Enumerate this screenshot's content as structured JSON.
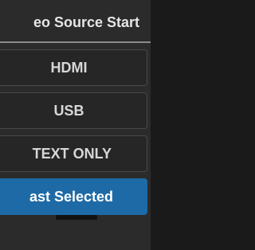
{
  "panel": {
    "title": "eo Source Start",
    "options": [
      {
        "label": "HDMI",
        "selected": false
      },
      {
        "label": "USB",
        "selected": false
      },
      {
        "label": "TEXT ONLY",
        "selected": false
      },
      {
        "label": "ast Selected",
        "selected": true
      }
    ]
  },
  "colors": {
    "background": "#1a1a1a",
    "panel": "#2b2b2b",
    "option": "#262626",
    "selected": "#1e6aa6",
    "divider": "#8a8a8a"
  }
}
